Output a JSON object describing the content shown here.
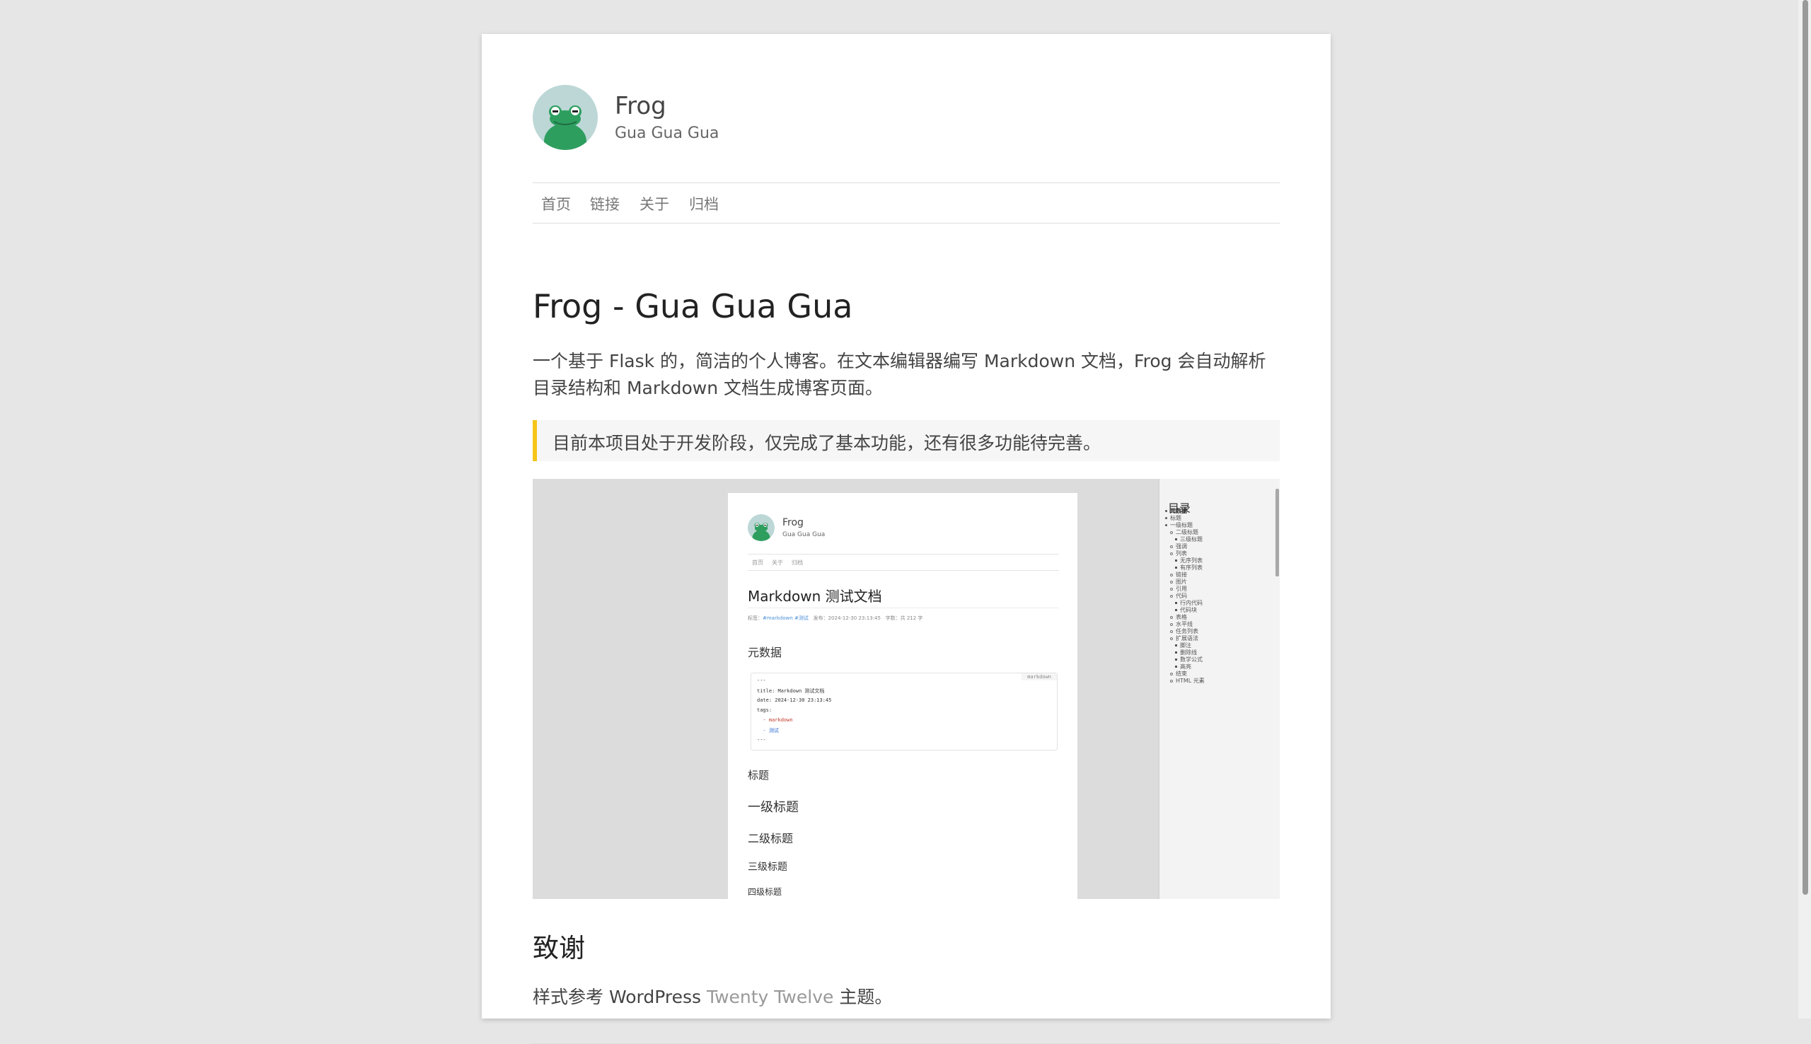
{
  "site": {
    "title": "Frog",
    "description": "Gua Gua Gua"
  },
  "nav": [
    "首页",
    "链接",
    "关于",
    "归档"
  ],
  "article": {
    "title": "Frog - Gua Gua Gua",
    "intro": "一个基于 Flask 的，简洁的个人博客。在文本编辑器编写 Markdown 文档，Frog 会自动解析目录结构和 Markdown 文档生成博客页面。",
    "quote": "目前本项目处于开发阶段，仅完成了基本功能，还有很多功能待完善。"
  },
  "screenshot": {
    "site_title": "Frog",
    "site_desc": "Gua Gua Gua",
    "nav": [
      "首页",
      "关于",
      "归档"
    ],
    "doc_title": "Markdown 测试文档",
    "meta_tags_label": "标签：",
    "meta_tags": "#markdown  #测试",
    "meta_date": "发布：2024-12-30 23:13:45",
    "meta_words": "字数：共 212 字",
    "section_meta": "元数据",
    "code_lang": "markdown",
    "code_lines": [
      "---",
      "title: Markdown 测试文档",
      "date: 2024-12-30 23:13:45",
      "tags:",
      "  - markdown",
      "  - 测试",
      "---"
    ],
    "headings": [
      "标题",
      "一级标题",
      "二级标题",
      "三级标题",
      "四级标题"
    ],
    "toc_title": "目录",
    "toc": [
      {
        "text": "元数据",
        "level": 1,
        "bold": true
      },
      {
        "text": "标题",
        "level": 1
      },
      {
        "text": "一级标题",
        "level": 1
      },
      {
        "text": "二级标题",
        "level": 2
      },
      {
        "text": "三级标题",
        "level": 3
      },
      {
        "text": "强调",
        "level": 2
      },
      {
        "text": "列表",
        "level": 2
      },
      {
        "text": "无序列表",
        "level": 3
      },
      {
        "text": "有序列表",
        "level": 3
      },
      {
        "text": "链接",
        "level": 2
      },
      {
        "text": "图片",
        "level": 2
      },
      {
        "text": "引用",
        "level": 2
      },
      {
        "text": "代码",
        "level": 2
      },
      {
        "text": "行内代码",
        "level": 3
      },
      {
        "text": "代码块",
        "level": 3
      },
      {
        "text": "表格",
        "level": 2
      },
      {
        "text": "水平线",
        "level": 2
      },
      {
        "text": "任务列表",
        "level": 2
      },
      {
        "text": "扩展语法",
        "level": 2
      },
      {
        "text": "脚注",
        "level": 3
      },
      {
        "text": "删除线",
        "level": 3
      },
      {
        "text": "数学公式",
        "level": 3
      },
      {
        "text": "高亮",
        "level": 3
      },
      {
        "text": "结束",
        "level": 2
      },
      {
        "text": "HTML 元素",
        "level": 2
      }
    ]
  },
  "thanks": {
    "title": "致谢",
    "before": "样式参考 WordPress ",
    "link": "Twenty Twelve",
    "after": " 主题。"
  },
  "colors": {
    "quote_border": "#f5c518",
    "frog_green": "#2e9e5f",
    "avatar_bg": "#bcd7d6"
  }
}
